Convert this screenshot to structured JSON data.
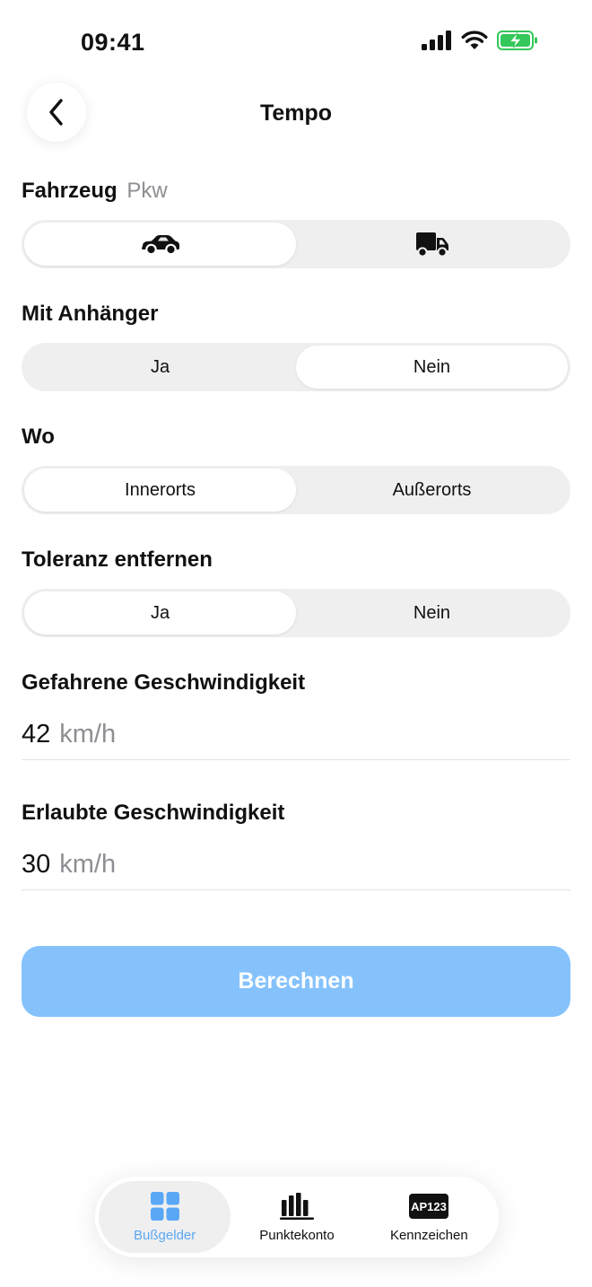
{
  "status_bar": {
    "time": "09:41",
    "icons": [
      "signal-icon",
      "wifi-icon",
      "battery-charging-icon"
    ],
    "battery_color": "#34c759"
  },
  "header": {
    "title": "Tempo",
    "back_icon": "chevron-left-icon"
  },
  "vehicle": {
    "label": "Fahrzeug",
    "value": "Pkw",
    "options": [
      {
        "icon": "car-icon",
        "selected": true
      },
      {
        "icon": "truck-icon",
        "selected": false
      }
    ]
  },
  "trailer": {
    "label": "Mit Anhänger",
    "options": [
      {
        "label": "Ja",
        "selected": false
      },
      {
        "label": "Nein",
        "selected": true
      }
    ]
  },
  "location": {
    "label": "Wo",
    "options": [
      {
        "label": "Innerorts",
        "selected": true
      },
      {
        "label": "Außerorts",
        "selected": false
      }
    ]
  },
  "tolerance": {
    "label": "Toleranz entfernen",
    "options": [
      {
        "label": "Ja",
        "selected": true
      },
      {
        "label": "Nein",
        "selected": false
      }
    ]
  },
  "driven_speed": {
    "label": "Gefahrene Geschwindigkeit",
    "value": "42",
    "unit": "km/h"
  },
  "allowed_speed": {
    "label": "Erlaubte Geschwindigkeit",
    "value": "30",
    "unit": "km/h"
  },
  "calculate_button": {
    "label": "Berechnen",
    "color": "#85c2fc"
  },
  "tabbar": {
    "items": [
      {
        "label": "Bußgelder",
        "icon": "grid-icon",
        "active": true
      },
      {
        "label": "Punktekonto",
        "icon": "bar-chart-icon",
        "active": false
      },
      {
        "label": "Kennzeichen",
        "icon": "license-plate-icon",
        "plate_text": "AP123",
        "active": false
      }
    ],
    "accent": "#5aa8f5"
  }
}
